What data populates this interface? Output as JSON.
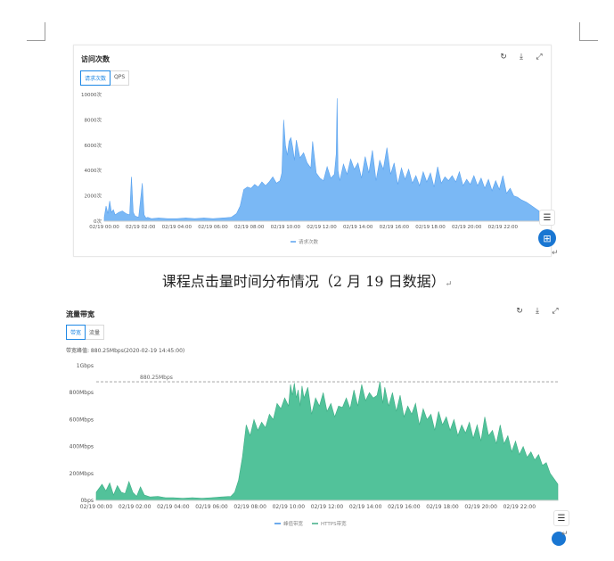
{
  "colors": {
    "chart1_fill": "#7ab8f5",
    "chart1_stroke": "#5aa2ef",
    "chart2_fill": "#52c29a",
    "chart2_stroke": "#3fae86",
    "accent": "#1e88e5"
  },
  "icons": [
    "refresh-icon",
    "download-icon",
    "expand-icon",
    "comment-icon",
    "grid-apps-icon",
    "return-mark-icon"
  ],
  "panel1": {
    "title": "访问次数",
    "tabs": [
      "请求次数",
      "QPS"
    ],
    "active_tab": 0
  },
  "caption": "课程点击量时间分布情况（2 月 19 日数据）",
  "return_mark": "↵",
  "panel2": {
    "title": "流量带宽",
    "tabs": [
      "带宽",
      "流量"
    ],
    "active_tab": 0,
    "peak_label": "带宽峰值: 880.25Mbps(2020-02-19 14:45:00)",
    "reference_label": "880.25Mbps"
  },
  "chart_data": [
    {
      "type": "area",
      "title": "访问次数",
      "ylim": [
        0,
        10000
      ],
      "y_tick_labels": [
        "0次",
        "2000次",
        "4000次",
        "6000次",
        "8000次",
        "10000次"
      ],
      "x_tick_labels": [
        "02/19 00:00",
        "02/19 02:00",
        "02/19 04:00",
        "02/19 06:00",
        "02/19 08:00",
        "02/19 10:00",
        "02/19 12:00",
        "02/19 14:00",
        "02/19 16:00",
        "02/19 18:00",
        "02/19 20:00",
        "02/19 22:00"
      ],
      "x_range_hours": [
        0,
        24
      ],
      "legend": [
        "请求次数"
      ],
      "legend_position": "bottom-center",
      "grid": false,
      "series": [
        {
          "name": "请求次数",
          "x": [
            0.0,
            0.1,
            0.2,
            0.3,
            0.4,
            0.5,
            0.6,
            0.8,
            1.0,
            1.2,
            1.4,
            1.5,
            1.6,
            1.7,
            1.9,
            2.1,
            2.2,
            2.3,
            2.4,
            2.6,
            3.0,
            3.5,
            4.0,
            4.5,
            5.0,
            5.5,
            6.0,
            6.5,
            7.0,
            7.3,
            7.5,
            7.7,
            7.9,
            8.1,
            8.3,
            8.5,
            8.7,
            8.9,
            9.1,
            9.3,
            9.5,
            9.7,
            9.8,
            9.9,
            10.0,
            10.1,
            10.2,
            10.3,
            10.4,
            10.5,
            10.6,
            10.8,
            11.0,
            11.2,
            11.4,
            11.5,
            11.7,
            11.9,
            12.1,
            12.3,
            12.5,
            12.7,
            12.8,
            12.85,
            12.9,
            13.0,
            13.2,
            13.4,
            13.6,
            13.8,
            14.0,
            14.2,
            14.4,
            14.6,
            14.8,
            15.0,
            15.2,
            15.4,
            15.6,
            15.8,
            16.0,
            16.2,
            16.4,
            16.6,
            16.8,
            17.0,
            17.2,
            17.4,
            17.6,
            17.8,
            18.0,
            18.2,
            18.4,
            18.6,
            18.8,
            19.0,
            19.2,
            19.4,
            19.6,
            19.8,
            20.0,
            20.2,
            20.4,
            20.6,
            20.8,
            21.0,
            21.2,
            21.4,
            21.6,
            21.8,
            22.0,
            22.2,
            22.4,
            22.6,
            22.8,
            23.0,
            23.3,
            23.6,
            24.0
          ],
          "values": [
            300,
            1200,
            600,
            1600,
            700,
            900,
            500,
            700,
            800,
            600,
            500,
            3500,
            700,
            400,
            300,
            3000,
            500,
            250,
            300,
            200,
            250,
            200,
            200,
            250,
            200,
            250,
            200,
            250,
            300,
            600,
            1200,
            2500,
            2700,
            2600,
            2900,
            2700,
            3100,
            2800,
            3100,
            3500,
            3000,
            3200,
            3800,
            8000,
            6000,
            5200,
            6300,
            6600,
            5800,
            4800,
            6400,
            5000,
            5400,
            4600,
            4200,
            6300,
            3800,
            3400,
            3200,
            4300,
            3400,
            3700,
            5300,
            9700,
            4000,
            3200,
            4500,
            3700,
            4900,
            4100,
            4600,
            3400,
            5100,
            3800,
            5600,
            3200,
            4800,
            4100,
            5800,
            3700,
            4600,
            2900,
            4200,
            3300,
            4100,
            3000,
            3600,
            2800,
            3900,
            3100,
            3800,
            2700,
            4300,
            3000,
            3500,
            3200,
            3600,
            3100,
            3900,
            2800,
            3300,
            2900,
            3600,
            2800,
            3400,
            2600,
            3300,
            2400,
            3200,
            2500,
            3600,
            2200,
            2600,
            2000,
            1900,
            1700,
            1500,
            1200,
            800
          ]
        }
      ]
    },
    {
      "type": "area",
      "title": "流量带宽",
      "ylim": [
        0,
        1000
      ],
      "y_tick_labels": [
        "0bps",
        "200Mbps",
        "400Mbps",
        "600Mbps",
        "800Mbps",
        "1Gbps"
      ],
      "x_tick_labels": [
        "02/19 00:00",
        "02/19 02:00",
        "02/19 04:00",
        "02/19 06:00",
        "02/19 08:00",
        "02/19 10:00",
        "02/19 12:00",
        "02/19 14:00",
        "02/19 16:00",
        "02/19 18:00",
        "02/19 20:00",
        "02/19 22:00"
      ],
      "x_range_hours": [
        0,
        24
      ],
      "reference_line": 880.25,
      "legend": [
        "峰值带宽",
        "HTTPS带宽"
      ],
      "legend_position": "bottom-center",
      "grid": false,
      "series": [
        {
          "name": "HTTPS带宽",
          "x": [
            0.0,
            0.3,
            0.5,
            0.7,
            0.9,
            1.1,
            1.3,
            1.5,
            1.7,
            1.9,
            2.1,
            2.3,
            2.5,
            2.8,
            3.2,
            3.6,
            4.0,
            4.5,
            5.0,
            5.5,
            6.0,
            6.5,
            7.0,
            7.2,
            7.4,
            7.6,
            7.8,
            8.0,
            8.2,
            8.4,
            8.6,
            8.8,
            9.0,
            9.2,
            9.4,
            9.6,
            9.8,
            10.0,
            10.1,
            10.2,
            10.3,
            10.4,
            10.5,
            10.6,
            10.7,
            10.8,
            11.0,
            11.2,
            11.4,
            11.6,
            11.8,
            12.0,
            12.2,
            12.4,
            12.6,
            12.8,
            13.0,
            13.2,
            13.4,
            13.6,
            13.8,
            14.0,
            14.2,
            14.4,
            14.6,
            14.75,
            14.9,
            15.0,
            15.2,
            15.4,
            15.6,
            15.8,
            16.0,
            16.2,
            16.4,
            16.6,
            16.8,
            17.0,
            17.2,
            17.4,
            17.6,
            17.8,
            18.0,
            18.2,
            18.4,
            18.6,
            18.8,
            19.0,
            19.2,
            19.4,
            19.6,
            19.8,
            20.0,
            20.2,
            20.4,
            20.6,
            20.8,
            21.0,
            21.2,
            21.4,
            21.6,
            21.8,
            22.0,
            22.2,
            22.4,
            22.6,
            22.8,
            23.0,
            23.2,
            23.4,
            23.6,
            23.8,
            24.0
          ],
          "values": [
            60,
            120,
            70,
            130,
            40,
            110,
            60,
            50,
            140,
            60,
            30,
            100,
            40,
            25,
            30,
            20,
            20,
            15,
            20,
            15,
            20,
            25,
            30,
            60,
            150,
            320,
            560,
            480,
            600,
            520,
            580,
            540,
            640,
            600,
            720,
            680,
            760,
            700,
            860,
            780,
            870,
            760,
            820,
            700,
            850,
            760,
            840,
            640,
            760,
            700,
            800,
            660,
            720,
            620,
            700,
            690,
            760,
            680,
            820,
            700,
            860,
            740,
            800,
            760,
            780,
            880,
            720,
            840,
            700,
            800,
            660,
            780,
            620,
            700,
            640,
            720,
            560,
            680,
            600,
            640,
            520,
            660,
            560,
            620,
            520,
            600,
            480,
            560,
            500,
            580,
            460,
            560,
            440,
            620,
            480,
            520,
            420,
            560,
            420,
            480,
            360,
            440,
            340,
            400,
            320,
            360,
            300,
            340,
            260,
            280,
            200,
            160,
            120
          ]
        }
      ]
    }
  ]
}
